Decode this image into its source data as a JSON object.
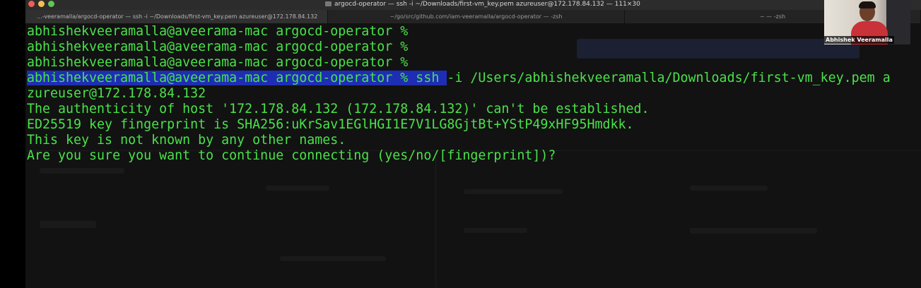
{
  "window": {
    "title": "argocd-operator — ssh -i ~/Downloads/first-vm_key.pem azureuser@172.178.84.132 — 111×30"
  },
  "tabs": [
    {
      "label": "...-veeramalla/argocd-operator — ssh -i ~/Downloads/first-vm_key.pem azureuser@172.178.84.132",
      "active": true
    },
    {
      "label": "~/go/src/github.com/iam-veeramalla/argocd-operator — -zsh",
      "active": false
    },
    {
      "label": "~ — -zsh",
      "active": false
    }
  ],
  "terminal": {
    "text_color": "#4ae24a",
    "selection_color": "#1e2eb4",
    "prompt": "abhishekveeramalla@aveerama-mac argocd-operator %",
    "lines": [
      {
        "selected": "",
        "rest": "abhishekveeramalla@aveerama-mac argocd-operator %"
      },
      {
        "selected": "",
        "rest": "abhishekveeramalla@aveerama-mac argocd-operator %"
      },
      {
        "selected": "",
        "rest": "abhishekveeramalla@aveerama-mac argocd-operator %"
      },
      {
        "selected": "abhishekveeramalla@aveerama-mac argocd-operator % ssh ",
        "rest": "-i /Users/abhishekveeramalla/Downloads/first-vm_key.pem a"
      },
      {
        "selected": "",
        "rest": "zureuser@172.178.84.132"
      },
      {
        "selected": "",
        "rest": "The authenticity of host '172.178.84.132 (172.178.84.132)' can't be established."
      },
      {
        "selected": "",
        "rest": "ED25519 key fingerprint is SHA256:uKrSav1EGlHGI1E7V1LG8GjtBt+YStP49xHF95Hmdkk."
      },
      {
        "selected": "",
        "rest": "This key is not known by any other names."
      },
      {
        "selected": "",
        "rest": "Are you sure you want to continue connecting (yes/no/[fingerprint])?"
      }
    ]
  },
  "webcam": {
    "name": "Abhishek Veeramalla"
  }
}
